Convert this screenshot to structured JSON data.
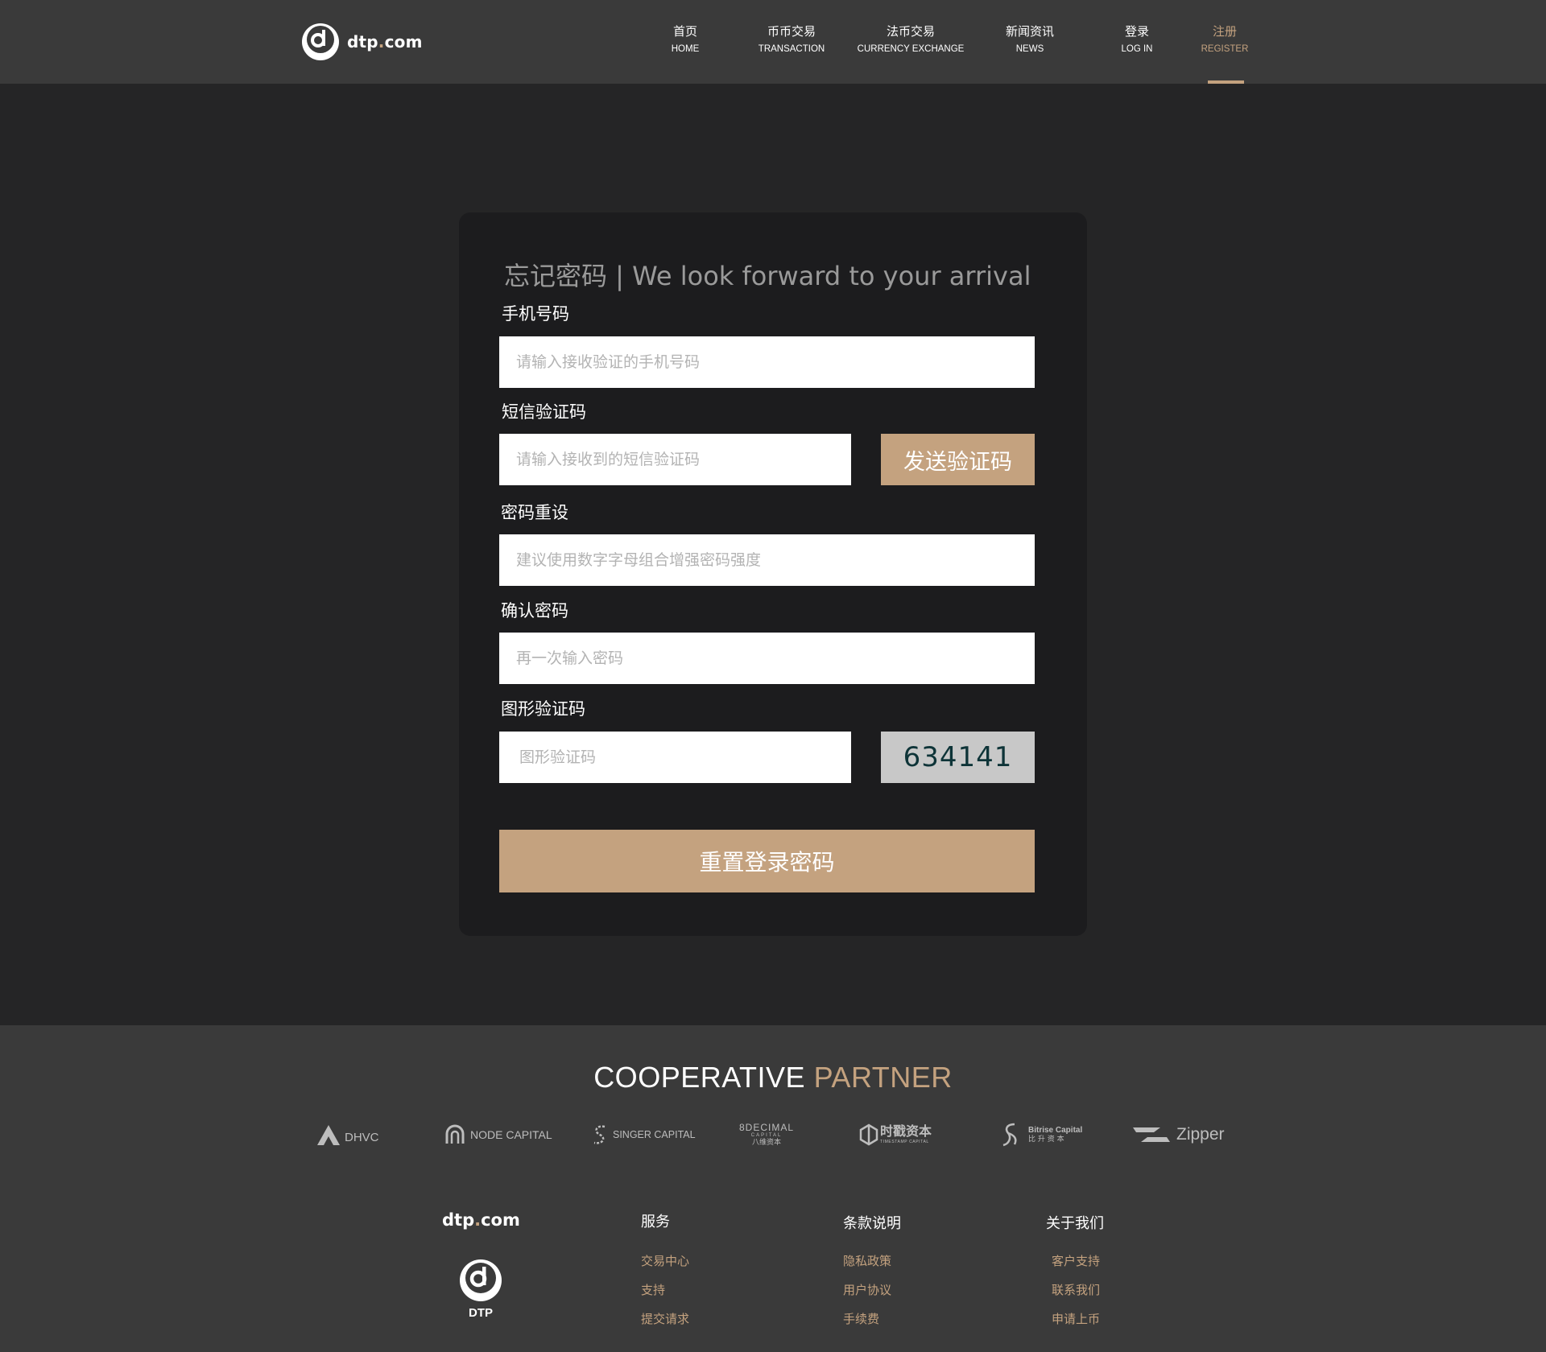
{
  "header": {
    "logo": {
      "name": "dtp",
      "dot": ".",
      "tld": "com"
    },
    "nav": [
      {
        "zh": "首页",
        "en": "HOME"
      },
      {
        "zh": "币币交易",
        "en": "TRANSACTION"
      },
      {
        "zh": "法币交易",
        "en": "CURRENCY EXCHANGE"
      },
      {
        "zh": "新闻资讯",
        "en": "NEWS"
      },
      {
        "zh": "登录",
        "en": "LOG IN"
      },
      {
        "zh": "注册",
        "en": "REGISTER",
        "active": true
      }
    ]
  },
  "form": {
    "title": "忘记密码 | We look forward to your arrival",
    "phone": {
      "label": "手机号码",
      "placeholder": "请输入接收验证的手机号码",
      "value": ""
    },
    "sms": {
      "label": "短信验证码",
      "placeholder": "请输入接收到的短信验证码",
      "value": "",
      "send_button": "发送验证码"
    },
    "password": {
      "label": "密码重设",
      "placeholder": "建议使用数字字母组合增强密码强度",
      "value": ""
    },
    "confirm": {
      "label": "确认密码",
      "placeholder": "再一次输入密码",
      "value": ""
    },
    "captcha": {
      "label": "图形验证码",
      "placeholder": "图形验证码",
      "value": "",
      "image_text": "634141"
    },
    "submit": "重置登录密码"
  },
  "footer": {
    "cooperative": {
      "word1": "COOPERATIVE",
      "word2": "PARTNER"
    },
    "partners": [
      {
        "name": "DHVC"
      },
      {
        "name": "NODE CAPITAL"
      },
      {
        "name": "SINGER CAPITAL"
      },
      {
        "name": "8DECIMAL",
        "sub1": "CAPITAL",
        "sub2": "八维资本"
      },
      {
        "name": "时戳资本",
        "sub1": "TIMESTAMP CAPITAL"
      },
      {
        "name": "Bitrise Capital",
        "sub1": "比 升 资 本"
      },
      {
        "name": "Zipper"
      }
    ],
    "logo": {
      "name": "dtp",
      "dot": ".",
      "tld": "com",
      "mark_label": "DTP"
    },
    "columns": [
      {
        "title": "服务",
        "links": [
          "交易中心",
          "支持",
          "提交请求"
        ]
      },
      {
        "title": "条款说明",
        "links": [
          "隐私政策",
          "用户协议",
          "手续费"
        ]
      },
      {
        "title": "关于我们",
        "links": [
          "客户支持",
          "联系我们",
          "申请上币"
        ]
      }
    ]
  },
  "colors": {
    "accent": "#c4a27f",
    "header_bg": "#3a3a3a",
    "page_bg": "#252526",
    "card_bg": "#1c1c1e",
    "captcha_bg": "#c8c8c8"
  }
}
